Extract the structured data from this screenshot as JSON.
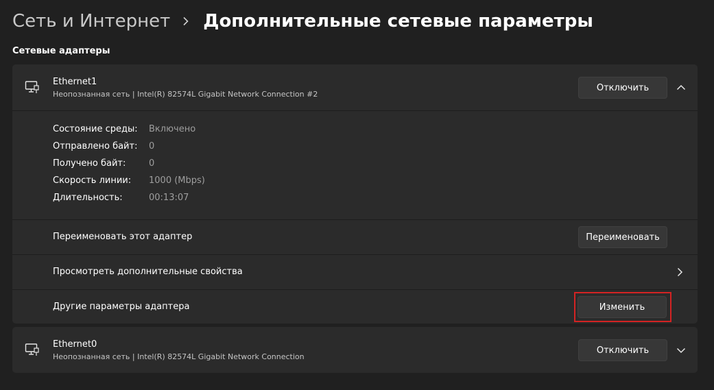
{
  "header": {
    "parent": "Сеть и Интернет",
    "current": "Дополнительные сетевые параметры"
  },
  "section_title": "Сетевые адаптеры",
  "adapters": [
    {
      "name": "Ethernet1",
      "description": "Неопознанная сеть | Intel(R) 82574L Gigabit Network Connection #2",
      "disable_label": "Отключить",
      "expanded": true,
      "icon": "ethernet-pc-icon",
      "details": [
        {
          "label": "Состояние среды:",
          "value": "Включено"
        },
        {
          "label": "Отправлено байт:",
          "value": "0"
        },
        {
          "label": "Получено байт:",
          "value": "0"
        },
        {
          "label": "Скорость линии:",
          "value": "1000 (Mbps)"
        },
        {
          "label": "Длительность:",
          "value": "00:13:07"
        }
      ],
      "rename": {
        "label": "Переименовать этот адаптер",
        "button": "Переименовать"
      },
      "properties": {
        "label": "Просмотреть дополнительные свойства"
      },
      "other": {
        "label": "Другие параметры адаптера",
        "button": "Изменить"
      }
    },
    {
      "name": "Ethernet0",
      "description": "Неопознанная сеть | Intel(R) 82574L Gigabit Network Connection",
      "disable_label": "Отключить",
      "expanded": false,
      "icon": "ethernet-pc-icon"
    }
  ],
  "colors": {
    "background": "#202020",
    "card": "#2b2b2b",
    "button": "#373737",
    "highlight": "#d42323",
    "muted_text": "#9e9e9e"
  }
}
